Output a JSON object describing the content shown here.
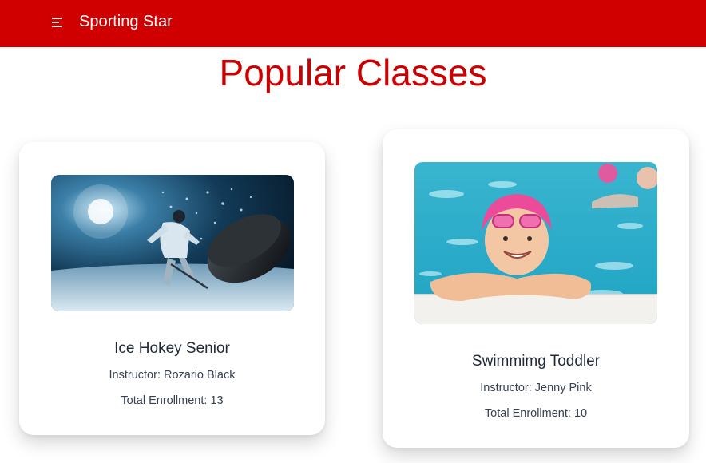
{
  "header": {
    "brand": "Sporting Star",
    "menu_icon": "menu-icon",
    "background_color": "#d00000"
  },
  "page": {
    "title": "Popular Classes",
    "title_color": "#cc0000"
  },
  "classes": [
    {
      "name": "Ice Hokey Senior",
      "instructor": "Instructor: Rozario Black",
      "enrollment": "Total Enrollment: 13",
      "image": "ice-hockey-photo"
    },
    {
      "name": "Swimmimg Toddler",
      "instructor": "Instructor: Jenny Pink",
      "enrollment": "Total Enrollment: 10",
      "image": "swimming-toddler-photo"
    }
  ]
}
